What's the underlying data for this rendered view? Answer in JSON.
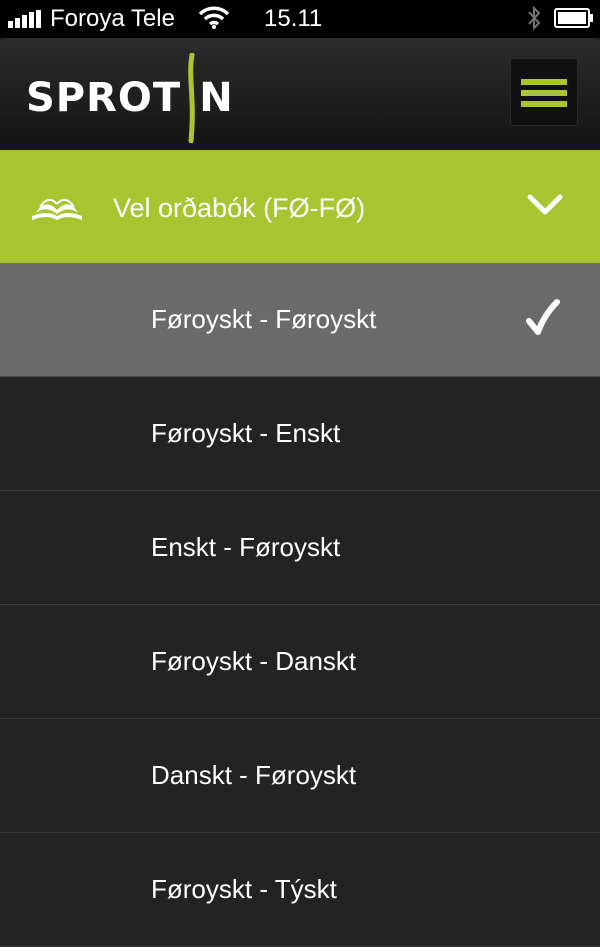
{
  "status_bar": {
    "carrier": "Foroya Tele",
    "time": "15.11",
    "icons": [
      "signal-icon",
      "wifi-icon",
      "bluetooth-icon",
      "battery-icon"
    ]
  },
  "header": {
    "logo_text": "SPROT",
    "logo_text_end": "N",
    "menu_icon": "hamburger-menu-icon"
  },
  "selector": {
    "label": "Vel orðabók (FØ-FØ)",
    "icon": "book-icon",
    "expand_icon": "chevron-down-icon"
  },
  "dictionaries": [
    {
      "label": "Føroyskt - Føroyskt",
      "selected": true
    },
    {
      "label": "Føroyskt - Enskt",
      "selected": false
    },
    {
      "label": "Enskt - Føroyskt",
      "selected": false
    },
    {
      "label": "Føroyskt - Danskt",
      "selected": false
    },
    {
      "label": "Danskt - Føroyskt",
      "selected": false
    },
    {
      "label": "Føroyskt - Týskt",
      "selected": false
    }
  ],
  "colors": {
    "accent": "#a8c531",
    "background": "#232323",
    "selected_row": "#6a6a6a",
    "header": "#1c1c1c"
  }
}
